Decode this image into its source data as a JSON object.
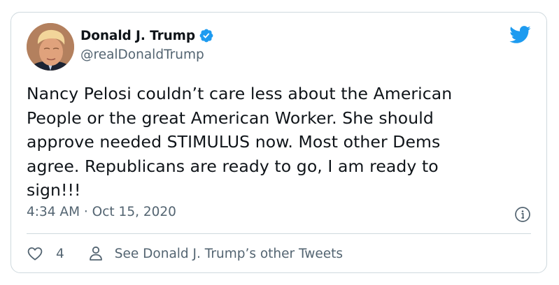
{
  "tweet": {
    "author": {
      "display_name": "Donald J. Trump",
      "handle": "@realDonaldTrump",
      "verified": true,
      "avatar_icon": "profile-photo"
    },
    "text": "Nancy Pelosi couldn’t care less about the American\nPeople or the great American Worker. She should\napprove needed STIMULUS now. Most other Dems\nagree. Republicans are ready to go, I am ready to\nsign!!!",
    "timestamp": "4:34 AM · Oct 15, 2020",
    "like_count": "4",
    "other_tweets_label": "See Donald J. Trump’s other Tweets"
  },
  "icons": {
    "logo": "twitter-bird-icon",
    "verified": "verified-badge-icon",
    "info": "info-icon",
    "like": "heart-icon",
    "profile": "person-icon"
  },
  "colors": {
    "brand": "#1d9bf0",
    "text": "#0f1419",
    "secondary": "#536471",
    "border": "#cfd9de"
  }
}
